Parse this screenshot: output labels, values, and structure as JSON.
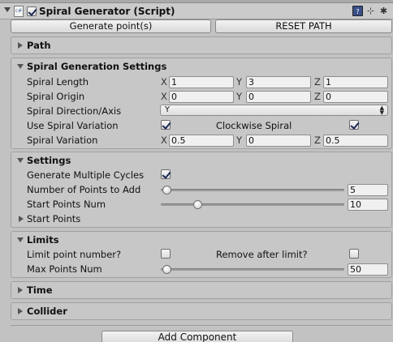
{
  "component": {
    "title": "Spiral Generator (Script)",
    "enabled": true,
    "icon_labels": [
      "book-icon",
      "preset-icon",
      "gear-icon"
    ]
  },
  "buttons": {
    "generate": "Generate point(s)",
    "reset": "RESET PATH"
  },
  "sections": {
    "path": {
      "title": "Path",
      "expanded": false
    },
    "spiral_settings": {
      "title": "Spiral Generation Settings",
      "expanded": true,
      "spiral_length": {
        "label": "Spiral Length",
        "x_label": "X",
        "x": "1",
        "y_label": "Y",
        "y": "3",
        "z_label": "Z",
        "z": "1"
      },
      "spiral_origin": {
        "label": "Spiral Origin",
        "x_label": "X",
        "x": "0",
        "y_label": "Y",
        "y": "0",
        "z_label": "Z",
        "z": "0"
      },
      "direction": {
        "label": "Spiral Direction/Axis",
        "value": "Y"
      },
      "use_variation": {
        "label": "Use Spiral Variation",
        "checked": true
      },
      "clockwise": {
        "label": "Clockwise Spiral",
        "checked": true
      },
      "spiral_variation": {
        "label": "Spiral Variation",
        "x_label": "X",
        "x": "0.5",
        "y_label": "Y",
        "y": "0",
        "z_label": "Z",
        "z": "0.5"
      }
    },
    "settings": {
      "title": "Settings",
      "expanded": true,
      "multiple_cycles": {
        "label": "Generate Multiple Cycles",
        "checked": true
      },
      "points_to_add": {
        "label": "Number of Points to Add",
        "value": "5",
        "fraction": 0.03
      },
      "start_points_num": {
        "label": "Start Points Num",
        "value": "10",
        "fraction": 0.2
      },
      "start_points": {
        "label": "Start Points",
        "expanded": false
      }
    },
    "limits": {
      "title": "Limits",
      "expanded": true,
      "limit_point_number": {
        "label": "Limit point number?",
        "checked": false
      },
      "remove_after_limit": {
        "label": "Remove after limit?",
        "checked": false
      },
      "max_points_num": {
        "label": "Max Points Num",
        "value": "50",
        "fraction": 0.03
      }
    },
    "time": {
      "title": "Time",
      "expanded": false
    },
    "collider": {
      "title": "Collider",
      "expanded": false
    }
  },
  "add_component": "Add Component"
}
